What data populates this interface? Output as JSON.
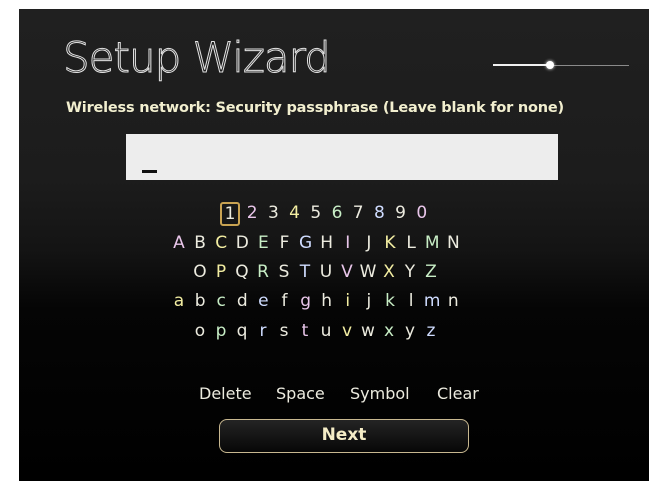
{
  "header": {
    "title": "Setup Wizard",
    "progress": 0.42
  },
  "prompt": {
    "label": "Wireless network: Security passphrase (Leave blank for none)"
  },
  "input": {
    "value": ""
  },
  "keyboard": {
    "selected_key": "1",
    "rows": [
      [
        "1",
        "2",
        "3",
        "4",
        "5",
        "6",
        "7",
        "8",
        "9",
        "0"
      ],
      [
        "A",
        "B",
        "C",
        "D",
        "E",
        "F",
        "G",
        "H",
        "I",
        "J",
        "K",
        "L",
        "M",
        "N"
      ],
      [
        "O",
        "P",
        "Q",
        "R",
        "S",
        "T",
        "U",
        "V",
        "W",
        "X",
        "Y",
        "Z"
      ],
      [
        "a",
        "b",
        "c",
        "d",
        "e",
        "f",
        "g",
        "h",
        "i",
        "j",
        "k",
        "l",
        "m",
        "n"
      ],
      [
        "o",
        "p",
        "q",
        "r",
        "s",
        "t",
        "u",
        "v",
        "w",
        "x",
        "y",
        "z"
      ]
    ]
  },
  "actions": {
    "delete": "Delete",
    "space": "Space",
    "symbol": "Symbol",
    "clear": "Clear",
    "next": "Next"
  },
  "colors": {
    "screen_bg": "#000000",
    "accent_border": "#c9a352",
    "text": "#ecebdf"
  }
}
